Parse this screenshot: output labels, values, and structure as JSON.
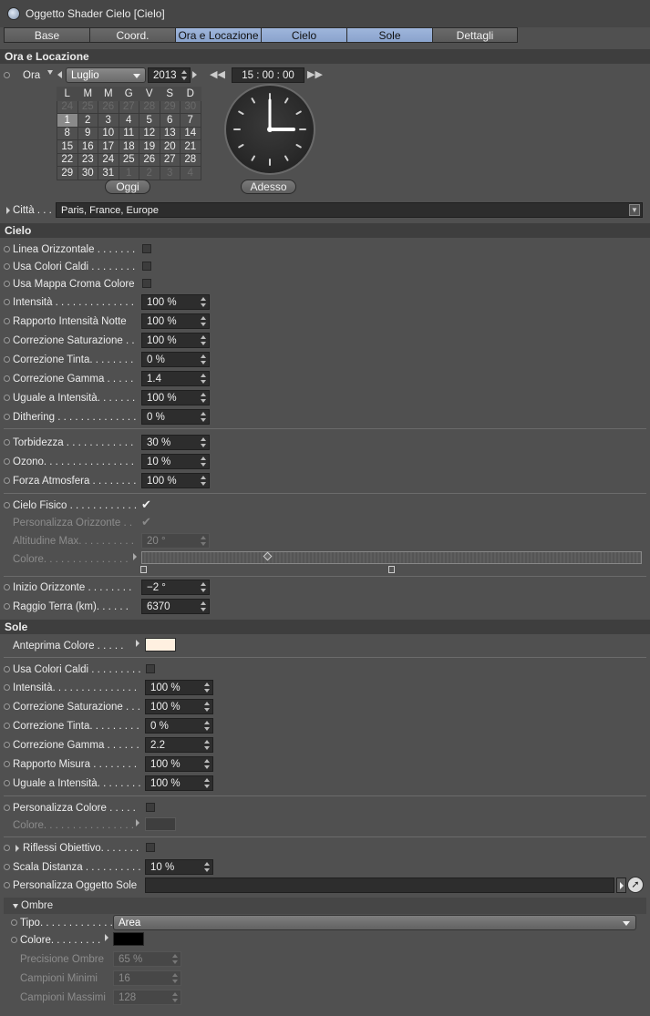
{
  "title": "Oggetto Shader Cielo [Cielo]",
  "tabs": [
    "Base",
    "Coord.",
    "Ora e Locazione",
    "Cielo",
    "Sole",
    "Dettagli"
  ],
  "time": {
    "section": "Ora e Locazione",
    "label": "Ora",
    "month": "Luglio",
    "year": "2013",
    "clock_text": "15 : 00 : 00",
    "weekdays": [
      "L",
      "M",
      "M",
      "G",
      "V",
      "S",
      "D"
    ],
    "weeks": [
      [
        "24",
        "25",
        "26",
        "27",
        "28",
        "29",
        "30"
      ],
      [
        "1",
        "2",
        "3",
        "4",
        "5",
        "6",
        "7"
      ],
      [
        "8",
        "9",
        "10",
        "11",
        "12",
        "13",
        "14"
      ],
      [
        "15",
        "16",
        "17",
        "18",
        "19",
        "20",
        "21"
      ],
      [
        "22",
        "23",
        "24",
        "25",
        "26",
        "27",
        "28"
      ],
      [
        "29",
        "30",
        "31",
        "1",
        "2",
        "3",
        "4"
      ]
    ],
    "today_button": "Oggi",
    "now_button": "Adesso",
    "city_label": "Città . . .",
    "city_value": "Paris, France, Europe"
  },
  "sky": {
    "section": "Cielo",
    "rows": [
      {
        "label": "Linea Orizzontale . . . . . . .",
        "type": "check",
        "checked": false
      },
      {
        "label": "Usa Colori Caldi . . . . . . . .",
        "type": "check",
        "checked": false
      },
      {
        "label": "Usa Mappa Croma Colore",
        "type": "check",
        "checked": false
      },
      {
        "label": "Intensità . . . . . . . . . . . . . .",
        "type": "num",
        "value": "100 %"
      },
      {
        "label": "Rapporto Intensità Notte",
        "type": "num",
        "value": "100 %"
      },
      {
        "label": "Correzione Saturazione . .",
        "type": "num",
        "value": "100 %"
      },
      {
        "label": "Correzione Tinta. . . . . . . .",
        "type": "num",
        "value": "0 %"
      },
      {
        "label": "Correzione Gamma . . . . .",
        "type": "num",
        "value": "1.4"
      },
      {
        "label": "Uguale a Intensità. . . . . . .",
        "type": "num",
        "value": "100 %"
      },
      {
        "label": "Dithering . . . . . . . . . . . . . .",
        "type": "num",
        "value": "0 %"
      }
    ],
    "atmo_rows": [
      {
        "label": "Torbidezza . . . . . . . . . . . .",
        "value": "30 %"
      },
      {
        "label": "Ozono. . . . . . . . . . . . . . . .",
        "value": "10 %"
      },
      {
        "label": "Forza Atmosfera . . . . . . . .",
        "value": "100 %"
      }
    ],
    "physical_label": "Cielo Fisico . . . . . . . . . . . .",
    "custom_horizon_label": "Personalizza Orizzonte . .",
    "max_alt_label": "Altitudine Max. . . . . . . . . .",
    "max_alt_value": "20 °",
    "color_label": "Colore. . . . . . . . . . . . . . .",
    "horizon_start_label": "Inizio Orizzonte . . . . . . . .",
    "horizon_start_value": "−2 °",
    "earth_radius_label": "Raggio Terra (km). . . . . .",
    "earth_radius_value": "6370"
  },
  "sun": {
    "section": "Sole",
    "preview_label": "Anteprima Colore . . . . .",
    "preview_color": "#fff0e0",
    "warm_label": "Usa Colori Caldi . . . . . . . . .",
    "rows": [
      {
        "label": "Intensità. . . . . . . . . . . . . . .",
        "value": "100 %"
      },
      {
        "label": "Correzione Saturazione . . .",
        "value": "100 %"
      },
      {
        "label": "Correzione Tinta. . . . . . . . .",
        "value": "0 %"
      },
      {
        "label": "Correzione Gamma . . . . . .",
        "value": "2.2"
      },
      {
        "label": "Rapporto Misura . . . . . . . .",
        "value": "100 %"
      },
      {
        "label": "Uguale a Intensità. . . . . . . .",
        "value": "100 %"
      }
    ],
    "custom_color_label": "Personalizza Colore . . . . .",
    "color_label": "Colore. . . . . . . . . . . . . . . .",
    "color_value": "#3e3e3e",
    "flare_label": "Riflessi Obiettivo. . . . . . .",
    "distance_label": "Scala Distanza . . . . . . . . . .",
    "distance_value": "10 %",
    "custom_object_label": "Personalizza Oggetto Sole"
  },
  "shadows": {
    "section": "Ombre",
    "type_label": "Tipo. . . . . . . . . . . . .",
    "type_value": "Area",
    "color_label": "Colore. . . . . . . . .",
    "color_value": "#000000",
    "rows": [
      {
        "label": "Precisione Ombre",
        "value": "65 %"
      },
      {
        "label": "Campioni Minimi",
        "value": "16"
      },
      {
        "label": "Campioni Massimi",
        "value": "128"
      }
    ]
  }
}
